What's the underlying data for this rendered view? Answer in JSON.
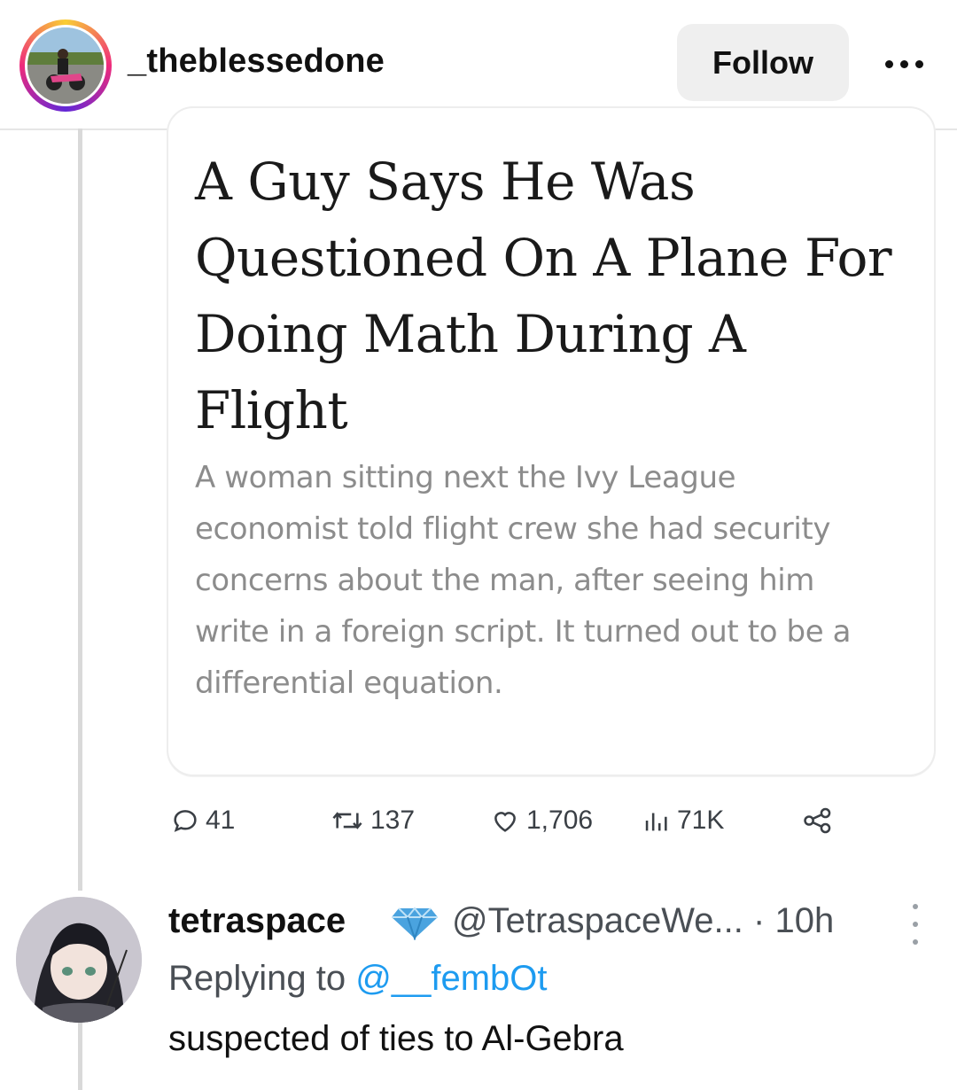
{
  "header": {
    "username": "_theblessedone",
    "follow_label": "Follow"
  },
  "article": {
    "headline": "A Guy Says He Was Questioned On A Plane For Doing Math During A Flight",
    "dek": "A woman sitting next the Ivy League economist told flight crew she had security concerns about the man, after seeing him write in a foreign script. It turned out to be a differential equation."
  },
  "actions": {
    "replies": "41",
    "retweets": "137",
    "likes": "1,706",
    "views": "71K"
  },
  "reply": {
    "name": "tetraspace",
    "handle": "@TetraspaceWe...",
    "separator": "·",
    "time": "10h",
    "replying_prefix": "Replying to",
    "replying_to": "@__fembOt",
    "text": "suspected of ties to Al-Gebra"
  },
  "colors": {
    "mention": "#1d9bf0",
    "verified": "#4aa3df",
    "follow_bg": "#efefef"
  }
}
